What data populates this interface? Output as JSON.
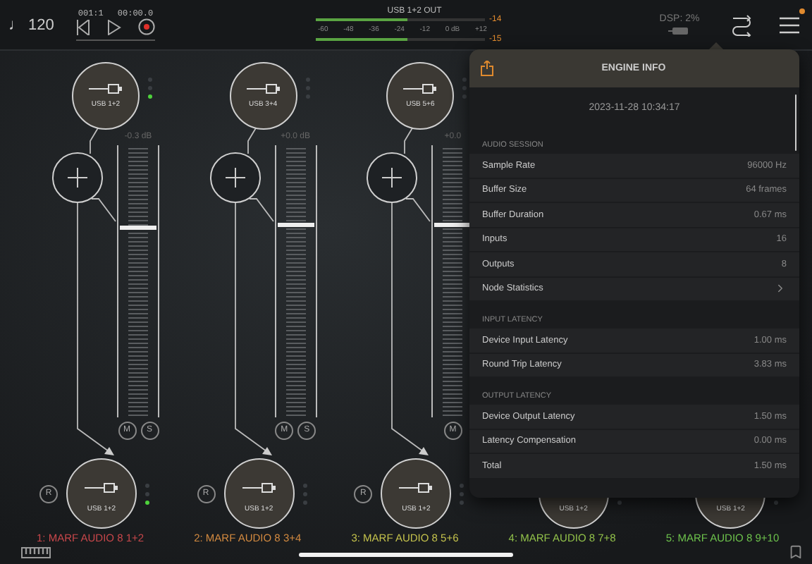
{
  "top_bar": {
    "tempo": "♩ 120",
    "position": "001:1",
    "time": "00:00.0",
    "record_armed": true,
    "meter": {
      "title": "USB 1+2 OUT",
      "scale": [
        "-60",
        "-48",
        "-36",
        "-24",
        "-12",
        "0 dB",
        "+12"
      ],
      "channels": [
        {
          "level": 0.54,
          "peak": "-14"
        },
        {
          "level": 0.54,
          "peak": "-15"
        }
      ]
    },
    "dsp": "DSP: 2%",
    "menu_badge": true
  },
  "channels": [
    {
      "name": "1: MARF AUDIO 8 1+2",
      "color": "#c8474b",
      "input": {
        "label": "USB 1+2",
        "signal": true
      },
      "reading": "-0.3 dB",
      "fader": {
        "level": 0.69
      },
      "buttons": [
        "M",
        "S"
      ],
      "record": "R",
      "output": {
        "label": "USB 1+2",
        "signal": true
      }
    },
    {
      "name": "2: MARF AUDIO 8 3+4",
      "color": "#d38a40",
      "input": {
        "label": "USB 3+4",
        "signal": false
      },
      "reading": "+0.0 dB",
      "fader": {
        "level": 0.7
      },
      "buttons": [
        "M",
        "S"
      ],
      "record": "R",
      "output": {
        "label": "USB 1+2",
        "signal": false
      }
    },
    {
      "name": "3: MARF AUDIO 8 5+6",
      "color": "#c4c24c",
      "input": {
        "label": "USB 5+6",
        "signal": false
      },
      "reading": "+0.0",
      "fader": {
        "level": 0.7
      },
      "buttons": [
        "M"
      ],
      "record": "R",
      "output": {
        "label": "USB 1+2",
        "signal": false
      }
    },
    {
      "name": "4: MARF AUDIO 8 7+8",
      "color": "#92c24a",
      "output": {
        "label": "USB 1+2",
        "signal": false
      }
    },
    {
      "name": "5: MARF AUDIO 8 9+10",
      "color": "#6dc24c",
      "output": {
        "label": "USB 1+2",
        "signal": false
      }
    }
  ],
  "engine_info": {
    "title": "ENGINE INFO",
    "timestamp": "2023-11-28 10:34:17",
    "sections": [
      {
        "title": "AUDIO SESSION",
        "rows": [
          {
            "kind": "value",
            "label": "Sample Rate",
            "value": "96000 Hz"
          },
          {
            "kind": "value",
            "label": "Buffer Size",
            "value": "64 frames"
          },
          {
            "kind": "value",
            "label": "Buffer Duration",
            "value": "0.67 ms"
          },
          {
            "kind": "value",
            "label": "Inputs",
            "value": "16"
          },
          {
            "kind": "value",
            "label": "Outputs",
            "value": "8"
          },
          {
            "kind": "link",
            "label": "Node Statistics"
          }
        ]
      },
      {
        "title": "INPUT LATENCY",
        "rows": [
          {
            "kind": "value",
            "label": "Device Input Latency",
            "value": "1.00 ms"
          },
          {
            "kind": "value",
            "label": "Round Trip Latency",
            "value": "3.83 ms"
          }
        ]
      },
      {
        "title": "OUTPUT LATENCY",
        "rows": [
          {
            "kind": "value",
            "label": "Device Output Latency",
            "value": "1.50 ms"
          },
          {
            "kind": "value",
            "label": "Latency Compensation",
            "value": "0.00 ms"
          },
          {
            "kind": "value",
            "label": "Total",
            "value": "1.50 ms"
          }
        ]
      }
    ]
  }
}
